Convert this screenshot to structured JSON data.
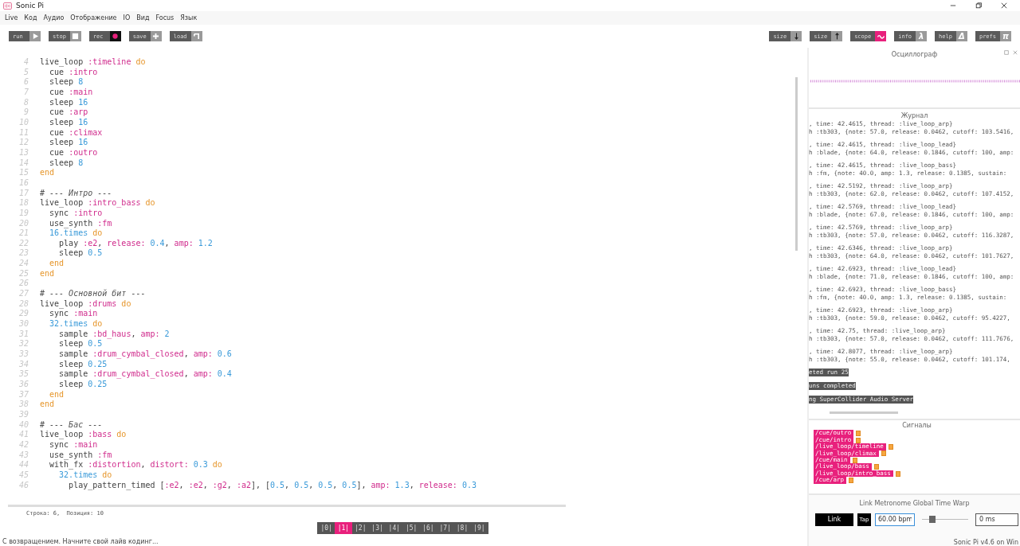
{
  "window": {
    "title": "Sonic Pi"
  },
  "menu": [
    "Live",
    "Код",
    "Аудио",
    "Отображение",
    "IO",
    "Вид",
    "Focus",
    "Язык"
  ],
  "toolbar_left": [
    {
      "label": "run"
    },
    {
      "label": "stop"
    },
    {
      "label": "rec"
    },
    {
      "label": "save"
    },
    {
      "label": "load"
    }
  ],
  "toolbar_right": [
    {
      "label": "size",
      "on": false
    },
    {
      "label": "size",
      "on": false
    },
    {
      "label": "scope",
      "on": true
    },
    {
      "label": "info",
      "glyph": "λ",
      "on": false
    },
    {
      "label": "help",
      "glyph": "Δ",
      "on": false
    },
    {
      "label": "prefs",
      "glyph": "π",
      "on": false
    }
  ],
  "editor": {
    "lines": [
      {
        "num": "4",
        "tokens": [
          {
            "kind": "plain",
            "text": "live_loop "
          },
          {
            "kind": "symbol",
            "text": ":timeline"
          },
          {
            "kind": "keyword",
            "text": " do"
          }
        ]
      },
      {
        "num": "5",
        "tokens": [
          {
            "kind": "plain",
            "text": "  cue "
          },
          {
            "kind": "symbol",
            "text": ":intro"
          }
        ]
      },
      {
        "num": "6",
        "tokens": [
          {
            "kind": "plain",
            "text": "  sleep "
          },
          {
            "kind": "number",
            "text": "8"
          }
        ]
      },
      {
        "num": "7",
        "tokens": [
          {
            "kind": "plain",
            "text": "  cue "
          },
          {
            "kind": "symbol",
            "text": ":main"
          }
        ]
      },
      {
        "num": "8",
        "tokens": [
          {
            "kind": "plain",
            "text": "  sleep "
          },
          {
            "kind": "number",
            "text": "16"
          }
        ]
      },
      {
        "num": "9",
        "tokens": [
          {
            "kind": "plain",
            "text": "  cue "
          },
          {
            "kind": "symbol",
            "text": ":arp"
          }
        ]
      },
      {
        "num": "10",
        "tokens": [
          {
            "kind": "plain",
            "text": "  sleep "
          },
          {
            "kind": "number",
            "text": "16"
          }
        ]
      },
      {
        "num": "11",
        "tokens": [
          {
            "kind": "plain",
            "text": "  cue "
          },
          {
            "kind": "symbol",
            "text": ":climax"
          }
        ]
      },
      {
        "num": "12",
        "tokens": [
          {
            "kind": "plain",
            "text": "  sleep "
          },
          {
            "kind": "number",
            "text": "16"
          }
        ]
      },
      {
        "num": "13",
        "tokens": [
          {
            "kind": "plain",
            "text": "  cue "
          },
          {
            "kind": "symbol",
            "text": ":outro"
          }
        ]
      },
      {
        "num": "14",
        "tokens": [
          {
            "kind": "plain",
            "text": "  sleep "
          },
          {
            "kind": "number",
            "text": "8"
          }
        ]
      },
      {
        "num": "15",
        "tokens": [
          {
            "kind": "keyword",
            "text": "end"
          }
        ]
      },
      {
        "num": "16"
      },
      {
        "num": "17",
        "tokens": [
          {
            "kind": "comment",
            "text": "# --- Интро ---"
          }
        ]
      },
      {
        "num": "18",
        "tokens": [
          {
            "kind": "plain",
            "text": "live_loop "
          },
          {
            "kind": "symbol",
            "text": ":intro_bass"
          },
          {
            "kind": "keyword",
            "text": " do"
          }
        ]
      },
      {
        "num": "19",
        "tokens": [
          {
            "kind": "plain",
            "text": "  sync "
          },
          {
            "kind": "symbol",
            "text": ":intro"
          }
        ]
      },
      {
        "num": "20",
        "tokens": [
          {
            "kind": "plain",
            "text": "  use_synth "
          },
          {
            "kind": "symbol",
            "text": ":fm"
          }
        ]
      },
      {
        "num": "21",
        "tokens": [
          {
            "kind": "number",
            "text": "  16.times"
          },
          {
            "kind": "keyword",
            "text": " do"
          }
        ]
      },
      {
        "num": "22",
        "tokens": [
          {
            "kind": "plain",
            "text": "    play "
          },
          {
            "kind": "symbol",
            "text": ":e2"
          },
          {
            "kind": "plain",
            "text": ", "
          },
          {
            "kind": "symbol",
            "text": "release:"
          },
          {
            "kind": "number",
            "text": " 0.4"
          },
          {
            "kind": "plain",
            "text": ", "
          },
          {
            "kind": "symbol",
            "text": "amp:"
          },
          {
            "kind": "number",
            "text": " 1.2"
          }
        ]
      },
      {
        "num": "23",
        "tokens": [
          {
            "kind": "plain",
            "text": "    sleep "
          },
          {
            "kind": "number",
            "text": "0.5"
          }
        ]
      },
      {
        "num": "24",
        "tokens": [
          {
            "kind": "keyword",
            "text": "  end"
          }
        ]
      },
      {
        "num": "25",
        "tokens": [
          {
            "kind": "keyword",
            "text": "end"
          }
        ]
      },
      {
        "num": "26"
      },
      {
        "num": "27",
        "tokens": [
          {
            "kind": "comment",
            "text": "# --- Основной бит ---"
          }
        ]
      },
      {
        "num": "28",
        "tokens": [
          {
            "kind": "plain",
            "text": "live_loop "
          },
          {
            "kind": "symbol",
            "text": ":drums"
          },
          {
            "kind": "keyword",
            "text": " do"
          }
        ]
      },
      {
        "num": "29",
        "tokens": [
          {
            "kind": "plain",
            "text": "  sync "
          },
          {
            "kind": "symbol",
            "text": ":main"
          }
        ]
      },
      {
        "num": "30",
        "tokens": [
          {
            "kind": "number",
            "text": "  32.times"
          },
          {
            "kind": "keyword",
            "text": " do"
          }
        ]
      },
      {
        "num": "31",
        "tokens": [
          {
            "kind": "plain",
            "text": "    sample "
          },
          {
            "kind": "symbol",
            "text": ":bd_haus"
          },
          {
            "kind": "plain",
            "text": ", "
          },
          {
            "kind": "symbol",
            "text": "amp:"
          },
          {
            "kind": "number",
            "text": " 2"
          }
        ]
      },
      {
        "num": "32",
        "tokens": [
          {
            "kind": "plain",
            "text": "    sleep "
          },
          {
            "kind": "number",
            "text": "0.5"
          }
        ]
      },
      {
        "num": "33",
        "tokens": [
          {
            "kind": "plain",
            "text": "    sample "
          },
          {
            "kind": "symbol",
            "text": ":drum_cymbal_closed"
          },
          {
            "kind": "plain",
            "text": ", "
          },
          {
            "kind": "symbol",
            "text": "amp:"
          },
          {
            "kind": "number",
            "text": " 0.6"
          }
        ]
      },
      {
        "num": "34",
        "tokens": [
          {
            "kind": "plain",
            "text": "    sleep "
          },
          {
            "kind": "number",
            "text": "0.25"
          }
        ]
      },
      {
        "num": "35",
        "tokens": [
          {
            "kind": "plain",
            "text": "    sample "
          },
          {
            "kind": "symbol",
            "text": ":drum_cymbal_closed"
          },
          {
            "kind": "plain",
            "text": ", "
          },
          {
            "kind": "symbol",
            "text": "amp:"
          },
          {
            "kind": "number",
            "text": " 0.4"
          }
        ]
      },
      {
        "num": "36",
        "tokens": [
          {
            "kind": "plain",
            "text": "    sleep "
          },
          {
            "kind": "number",
            "text": "0.25"
          }
        ]
      },
      {
        "num": "37",
        "tokens": [
          {
            "kind": "keyword",
            "text": "  end"
          }
        ]
      },
      {
        "num": "38",
        "tokens": [
          {
            "kind": "keyword",
            "text": "end"
          }
        ]
      },
      {
        "num": "39"
      },
      {
        "num": "40",
        "tokens": [
          {
            "kind": "comment",
            "text": "# --- Бас ---"
          }
        ]
      },
      {
        "num": "41",
        "tokens": [
          {
            "kind": "plain",
            "text": "live_loop "
          },
          {
            "kind": "symbol",
            "text": ":bass"
          },
          {
            "kind": "keyword",
            "text": " do"
          }
        ]
      },
      {
        "num": "42",
        "tokens": [
          {
            "kind": "plain",
            "text": "  sync "
          },
          {
            "kind": "symbol",
            "text": ":main"
          }
        ]
      },
      {
        "num": "43",
        "tokens": [
          {
            "kind": "plain",
            "text": "  use_synth "
          },
          {
            "kind": "symbol",
            "text": ":fm"
          }
        ]
      },
      {
        "num": "44",
        "tokens": [
          {
            "kind": "plain",
            "text": "  with_fx "
          },
          {
            "kind": "symbol",
            "text": ":distortion"
          },
          {
            "kind": "plain",
            "text": ", "
          },
          {
            "kind": "symbol",
            "text": "distort:"
          },
          {
            "kind": "number",
            "text": " 0.3"
          },
          {
            "kind": "keyword",
            "text": " do"
          }
        ]
      },
      {
        "num": "45",
        "tokens": [
          {
            "kind": "number",
            "text": "    32.times"
          },
          {
            "kind": "keyword",
            "text": " do"
          }
        ]
      },
      {
        "num": "46",
        "tokens": [
          {
            "kind": "plain",
            "text": "      play_pattern_timed ["
          },
          {
            "kind": "symbol",
            "text": ":e2"
          },
          {
            "kind": "plain",
            "text": ", "
          },
          {
            "kind": "symbol",
            "text": ":e2"
          },
          {
            "kind": "plain",
            "text": ", "
          },
          {
            "kind": "symbol",
            "text": ":g2"
          },
          {
            "kind": "plain",
            "text": ", "
          },
          {
            "kind": "symbol",
            "text": ":a2"
          },
          {
            "kind": "plain",
            "text": "], ["
          },
          {
            "kind": "number",
            "text": "0.5"
          },
          {
            "kind": "plain",
            "text": ", "
          },
          {
            "kind": "number",
            "text": "0.5"
          },
          {
            "kind": "plain",
            "text": ", "
          },
          {
            "kind": "number",
            "text": "0.5"
          },
          {
            "kind": "plain",
            "text": ", "
          },
          {
            "kind": "number",
            "text": "0.5"
          },
          {
            "kind": "plain",
            "text": "], "
          },
          {
            "kind": "symbol",
            "text": "amp:"
          },
          {
            "kind": "number",
            "text": " 1.3"
          },
          {
            "kind": "plain",
            "text": ", "
          },
          {
            "kind": "symbol",
            "text": "release:"
          },
          {
            "kind": "number",
            "text": " 0.3"
          }
        ]
      }
    ]
  },
  "cursor": "Строка: 6,  Позиция: 10",
  "buffers": [
    {
      "label": "|0|",
      "selected": false
    },
    {
      "label": "|1|",
      "selected": true
    },
    {
      "label": "|2|",
      "selected": false
    },
    {
      "label": "|3|",
      "selected": false
    },
    {
      "label": "|4|",
      "selected": false
    },
    {
      "label": "|5|",
      "selected": false
    },
    {
      "label": "|6|",
      "selected": false
    },
    {
      "label": "|7|",
      "selected": false
    },
    {
      "label": "|8|",
      "selected": false
    },
    {
      "label": "|9|",
      "selected": false
    }
  ],
  "scope": {
    "title": "Осциллограф"
  },
  "log": {
    "title": "Журнал",
    "entries": [
      {
        "head": ", time: 42.4615, thread: :live_loop_arp}",
        "body": "h :tb303, {note: 57.0, release: 0.0462, cutoff: 103.5416,"
      },
      {
        "head": ", time: 42.4615, thread: :live_loop_lead}",
        "body": "h :blade, {note: 64.0, release: 0.1846, cutoff: 100, amp:"
      },
      {
        "head": ", time: 42.4615, thread: :live_loop_bass}",
        "body": "h :fm, {note: 40.0, amp: 1.3, release: 0.1385, sustain:"
      },
      {
        "head": ", time: 42.5192, thread: :live_loop_arp}",
        "body": "h :tb303, {note: 62.0, release: 0.0462, cutoff: 107.4152,"
      },
      {
        "head": ", time: 42.5769, thread: :live_loop_lead}",
        "body": "h :blade, {note: 67.0, release: 0.1846, cutoff: 100, amp:"
      },
      {
        "head": ", time: 42.5769, thread: :live_loop_arp}",
        "body": "h :tb303, {note: 57.0, release: 0.0462, cutoff: 116.3287,"
      },
      {
        "head": ", time: 42.6346, thread: :live_loop_arp}",
        "body": "h :tb303, {note: 64.0, release: 0.0462, cutoff: 101.7627,"
      },
      {
        "head": ", time: 42.6923, thread: :live_loop_lead}",
        "body": "h :blade, {note: 71.0, release: 0.1846, cutoff: 100, amp:"
      },
      {
        "head": ", time: 42.6923, thread: :live_loop_bass}",
        "body": "h :fm, {note: 40.0, amp: 1.3, release: 0.1385, sustain:"
      },
      {
        "head": ", time: 42.6923, thread: :live_loop_arp}",
        "body": "h :tb303, {note: 59.0, release: 0.0462, cutoff: 95.4227,"
      },
      {
        "head": ", time: 42.75, thread: :live_loop_arp}",
        "body": "h :tb303, {note: 57.0, release: 0.0462, cutoff: 111.7676,"
      },
      {
        "head": ", time: 42.8077, thread: :live_loop_arp}",
        "body": "h :tb303, {note: 55.0, release: 0.0462, cutoff: 101.174,"
      }
    ],
    "messages": [
      "eted run 25",
      "uns completed",
      "ng SuperCollider Audio Server"
    ]
  },
  "cues": {
    "title": "Сигналы",
    "items": [
      "/cue/outro",
      "/cue/intro",
      "/live_loop/timeline",
      "/live_loop/climax",
      "/cue/main",
      "/live_loop/bass",
      "/live_loop/intro_bass",
      "/cue/arp"
    ]
  },
  "link": {
    "title": "Link Metronome Global Time Warp",
    "link_button": "Link",
    "tap_button": "Tap",
    "bpm": "60.00 bpm",
    "level": 0.15,
    "warp": "0 ms"
  },
  "status": {
    "message": "С возвращением. Начните свой лайв кодинг...",
    "version": "Sonic Pi v4.6 on Win"
  }
}
